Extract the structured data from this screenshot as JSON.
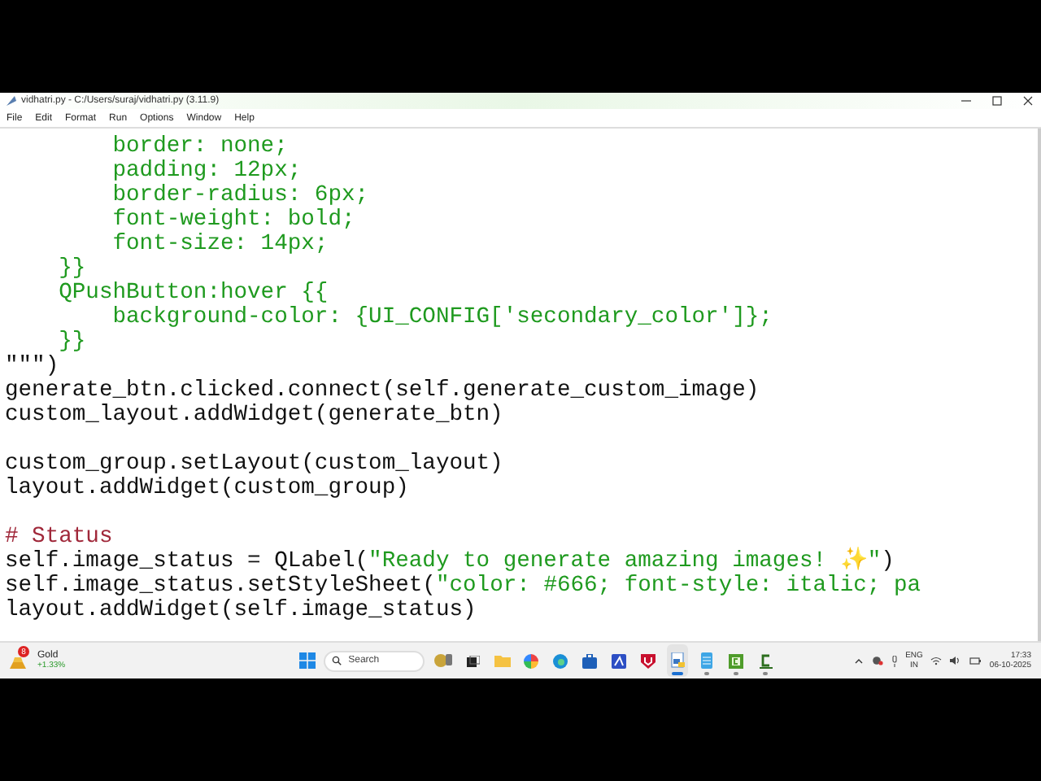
{
  "window": {
    "title": "vidhatri.py - C:/Users/suraj/vidhatri.py (3.11.9)"
  },
  "menu": [
    "File",
    "Edit",
    "Format",
    "Run",
    "Options",
    "Window",
    "Help"
  ],
  "code_lines": [
    {
      "kind": "code",
      "segments": [
        {
          "kind": "string",
          "text": "        border: none;"
        }
      ]
    },
    {
      "kind": "code",
      "segments": [
        {
          "kind": "string",
          "text": "        padding: 12px;"
        }
      ]
    },
    {
      "kind": "code",
      "segments": [
        {
          "kind": "string",
          "text": "        border-radius: 6px;"
        }
      ]
    },
    {
      "kind": "code",
      "segments": [
        {
          "kind": "string",
          "text": "        font-weight: bold;"
        }
      ]
    },
    {
      "kind": "code",
      "segments": [
        {
          "kind": "string",
          "text": "        font-size: 14px;"
        }
      ]
    },
    {
      "kind": "code",
      "segments": [
        {
          "kind": "string",
          "text": "    }}"
        }
      ]
    },
    {
      "kind": "code",
      "segments": [
        {
          "kind": "string",
          "text": "    QPushButton:hover {{"
        }
      ]
    },
    {
      "kind": "code",
      "segments": [
        {
          "kind": "string",
          "text": "        background-color: {UI_CONFIG['secondary_color']};"
        }
      ]
    },
    {
      "kind": "code",
      "segments": [
        {
          "kind": "string",
          "text": "    }}"
        }
      ]
    },
    {
      "kind": "code",
      "segments": [
        {
          "kind": "plain",
          "text": "\"\"\")"
        }
      ]
    },
    {
      "kind": "code",
      "segments": [
        {
          "kind": "plain",
          "text": "generate_btn.clicked.connect(self.generate_custom_image)"
        }
      ]
    },
    {
      "kind": "code",
      "segments": [
        {
          "kind": "plain",
          "text": "custom_layout.addWidget(generate_btn)"
        }
      ]
    },
    {
      "kind": "blank"
    },
    {
      "kind": "code",
      "segments": [
        {
          "kind": "plain",
          "text": "custom_group.setLayout(custom_layout)"
        }
      ]
    },
    {
      "kind": "code",
      "segments": [
        {
          "kind": "plain",
          "text": "layout.addWidget(custom_group)"
        }
      ]
    },
    {
      "kind": "blank"
    },
    {
      "kind": "code",
      "segments": [
        {
          "kind": "comment",
          "text": "# Status"
        }
      ]
    },
    {
      "kind": "code",
      "segments": [
        {
          "kind": "plain",
          "text": "self.image_status = QLabel("
        },
        {
          "kind": "string",
          "text": "\"Ready to generate amazing images! ✨\""
        },
        {
          "kind": "plain",
          "text": ")"
        }
      ]
    },
    {
      "kind": "code",
      "segments": [
        {
          "kind": "plain",
          "text": "self.image_status.setStyleSheet("
        },
        {
          "kind": "string",
          "text": "\"color: #666; font-style: italic; pa"
        }
      ]
    },
    {
      "kind": "code",
      "segments": [
        {
          "kind": "plain",
          "text": "layout.addWidget(self.image_status)"
        }
      ]
    }
  ],
  "taskbar": {
    "widget": {
      "badge": "8",
      "title": "Gold",
      "change": "+1.33%"
    },
    "search": {
      "placeholder": "Search"
    },
    "apps": [
      {
        "kind": "coin",
        "running": false,
        "selected": false
      },
      {
        "kind": "taskview",
        "running": false,
        "selected": false
      },
      {
        "kind": "folder",
        "running": false,
        "selected": false
      },
      {
        "kind": "colorwheel",
        "running": false,
        "selected": false
      },
      {
        "kind": "browser",
        "running": false,
        "selected": false
      },
      {
        "kind": "store",
        "running": false,
        "selected": false
      },
      {
        "kind": "bluetile",
        "running": false,
        "selected": false
      },
      {
        "kind": "shield",
        "running": false,
        "selected": false
      },
      {
        "kind": "python",
        "running": true,
        "selected": true
      },
      {
        "kind": "notepad",
        "running": true,
        "selected": false
      },
      {
        "kind": "greenc",
        "running": true,
        "selected": false
      },
      {
        "kind": "c",
        "running": true,
        "selected": false
      }
    ],
    "tray": {
      "language": "ENG",
      "region": "IN",
      "time": "17:33",
      "date": "06-10-2025"
    }
  }
}
